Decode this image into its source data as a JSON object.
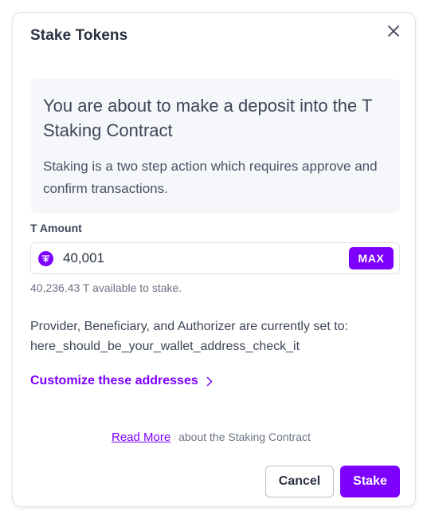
{
  "modal": {
    "title": "Stake Tokens",
    "close_icon": "close-icon"
  },
  "info": {
    "heading": "You are about to make a deposit into the T Staking Contract",
    "text": "Staking is a two step action which requires approve and confirm transactions."
  },
  "amount": {
    "label": "T Amount",
    "token_icon": "t-token-icon",
    "value": "40,001",
    "max_label": "MAX",
    "available_text": "40,236.43 T available to stake."
  },
  "addresses": {
    "text_line1": "Provider, Beneficiary, and Authorizer are currently set to:",
    "text_line2": "here_should_be_your_wallet_address_check_it",
    "customize_label": "Customize these addresses",
    "customize_icon": "chevron-right-icon"
  },
  "footer": {
    "read_more_label": "Read More",
    "read_more_suffix": "about the Staking Contract",
    "cancel_label": "Cancel",
    "stake_label": "Stake"
  },
  "colors": {
    "accent": "#7d00ff",
    "info_bg": "#f5f7fa",
    "border": "#dfe2e8"
  }
}
